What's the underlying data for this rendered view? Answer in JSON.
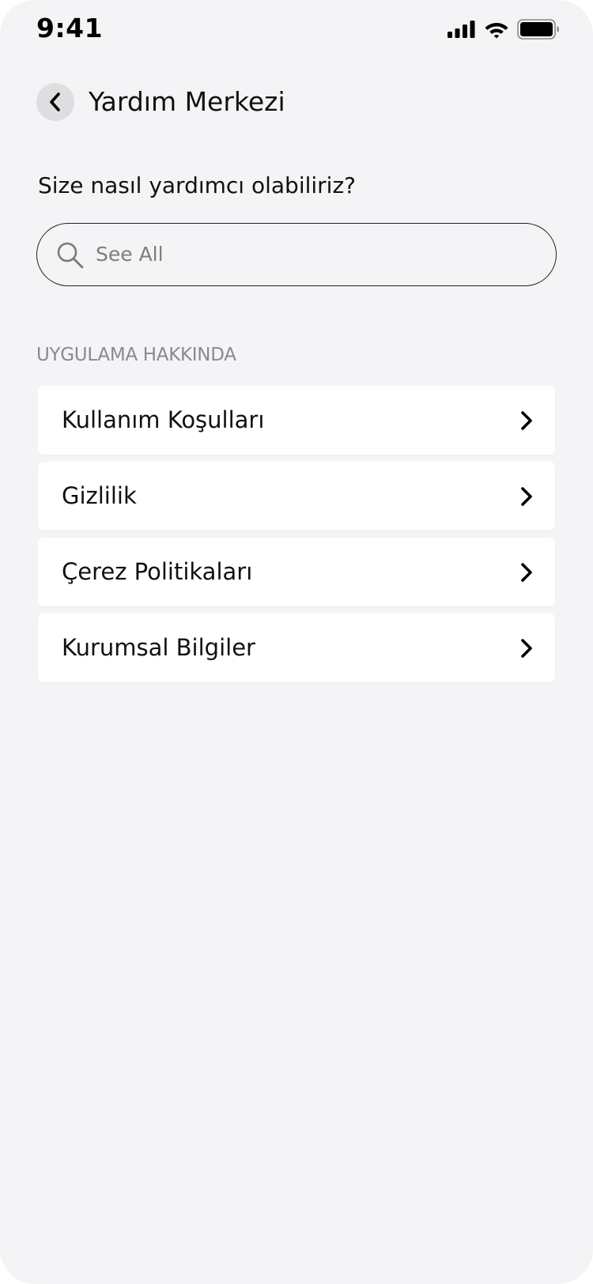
{
  "status_bar": {
    "time": "9:41",
    "icons": [
      "cellular-signal-icon",
      "wifi-icon",
      "battery-icon"
    ]
  },
  "header": {
    "back_icon": "chevron-left-icon",
    "title": "Yardım Merkezi"
  },
  "help": {
    "question": "Size nasıl yardımcı olabiliriz?"
  },
  "search": {
    "icon": "search-icon",
    "placeholder": "See All"
  },
  "section": {
    "label": "UYGULAMA HAKKINDA",
    "items": [
      {
        "label": "Kullanım Koşulları",
        "icon": "chevron-right-icon"
      },
      {
        "label": "Gizlilik",
        "icon": "chevron-right-icon"
      },
      {
        "label": "Çerez Politikaları",
        "icon": "chevron-right-icon"
      },
      {
        "label": "Kurumsal Bilgiler",
        "icon": "chevron-right-icon"
      }
    ]
  },
  "colors": {
    "background": "#f4f4f6",
    "card": "#ffffff",
    "text": "#111111",
    "muted": "#8a8a8e",
    "back_button_bg": "#dedee0"
  }
}
